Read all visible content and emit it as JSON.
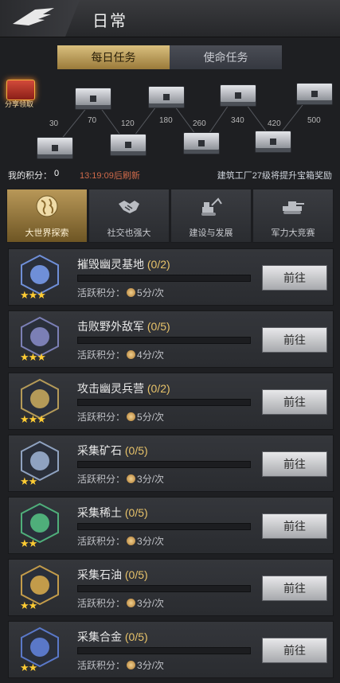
{
  "header": {
    "title": "日常"
  },
  "tabs": {
    "daily": "每日任务",
    "mission": "使命任务"
  },
  "rewards": {
    "share_label": "分享领取",
    "levels": [
      "30",
      "70",
      "120",
      "180",
      "260",
      "340",
      "420",
      "500"
    ],
    "my_score_label": "我的积分：",
    "my_score_value": "0",
    "timer": "13:19:09后刷新",
    "factory_note": "建筑工厂27级将提升宝箱奖励"
  },
  "categories": [
    {
      "label": "大世界探索",
      "icon": "globe-icon",
      "active": true
    },
    {
      "label": "社交也强大",
      "icon": "handshake-icon",
      "active": false
    },
    {
      "label": "建设与发展",
      "icon": "excavator-icon",
      "active": false
    },
    {
      "label": "军力大竞赛",
      "icon": "tank-icon",
      "active": false
    }
  ],
  "tasks": [
    {
      "name": "摧毁幽灵基地",
      "count": "(0/2)",
      "score_label": "活跃积分：",
      "score": "5分/次",
      "button": "前往",
      "stars": "★★★",
      "badge_color": "#6f8fd8"
    },
    {
      "name": "击败野外敌军",
      "count": "(0/5)",
      "score_label": "活跃积分：",
      "score": "4分/次",
      "button": "前往",
      "stars": "★★★",
      "badge_color": "#7b7fb5"
    },
    {
      "name": "攻击幽灵兵营",
      "count": "(0/2)",
      "score_label": "活跃积分：",
      "score": "5分/次",
      "button": "前往",
      "stars": "★★★",
      "badge_color": "#b49a58"
    },
    {
      "name": "采集矿石",
      "count": "(0/5)",
      "score_label": "活跃积分：",
      "score": "3分/次",
      "button": "前往",
      "stars": "★★",
      "badge_color": "#8fa2c0"
    },
    {
      "name": "采集稀土",
      "count": "(0/5)",
      "score_label": "活跃积分：",
      "score": "3分/次",
      "button": "前往",
      "stars": "★★",
      "badge_color": "#4fae7a"
    },
    {
      "name": "采集石油",
      "count": "(0/5)",
      "score_label": "活跃积分：",
      "score": "3分/次",
      "button": "前往",
      "stars": "★★",
      "badge_color": "#c29b4a"
    },
    {
      "name": "采集合金",
      "count": "(0/5)",
      "score_label": "活跃积分：",
      "score": "3分/次",
      "button": "前往",
      "stars": "★★",
      "badge_color": "#5a78c8"
    }
  ]
}
